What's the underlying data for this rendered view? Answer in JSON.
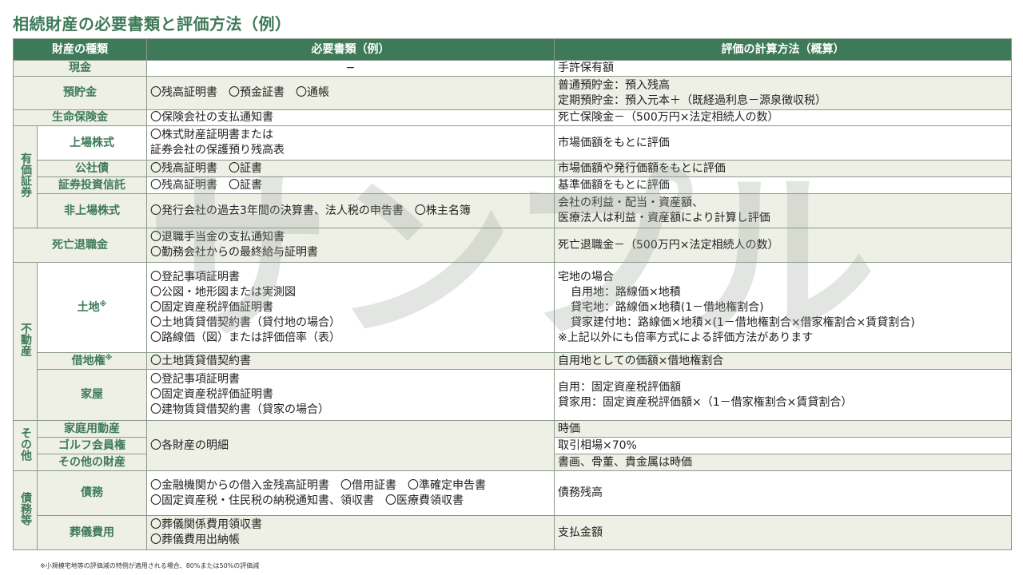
{
  "title": "相続財産の必要書類と評価方法（例）",
  "watermark_text": "サンプル",
  "headers": {
    "type": "財産の種類",
    "docs": "必要書類（例）",
    "eval": "評価の計算方法（概算）"
  },
  "groups": {
    "securities": "有価証券",
    "real_estate": "不動産",
    "other": "その他",
    "debts": "債務等"
  },
  "rows": {
    "cash": {
      "name": "現金",
      "docs": [
        "−"
      ],
      "eval": [
        "手許保有額"
      ]
    },
    "deposits": {
      "name": "預貯金",
      "docs": [
        "〇残高証明書　〇預金証書　〇通帳"
      ],
      "eval": [
        "普通預貯金：預入残高",
        "定期預貯金：預入元本＋（既経過利息－源泉徴収税）"
      ]
    },
    "life_insurance": {
      "name": "生命保険金",
      "docs": [
        "〇保険会社の支払通知書"
      ],
      "eval": [
        "死亡保険金－（500万円×法定相続人の数）"
      ]
    },
    "listed_stock": {
      "name": "上場株式",
      "docs": [
        "〇株式財産証明書または",
        "証券会社の保護預り残高表"
      ],
      "eval": [
        "市場価額をもとに評価"
      ]
    },
    "corporate_bonds": {
      "name": "公社債",
      "docs": [
        "〇残高証明書　〇証書"
      ],
      "eval": [
        "市場価額や発行価額をもとに評価"
      ]
    },
    "investment_trust": {
      "name": "証券投資信託",
      "docs": [
        "〇残高証明書　〇証書"
      ],
      "eval": [
        "基準価額をもとに評価"
      ]
    },
    "unlisted_stock": {
      "name": "非上場株式",
      "docs": [
        "〇発行会社の過去3年間の決算書、法人税の申告書　〇株主名簿"
      ],
      "eval": [
        "会社の利益・配当・資産額、",
        "医療法人は利益・資産額により計算し評価"
      ]
    },
    "retirement": {
      "name": "死亡退職金",
      "docs": [
        "〇退職手当金の支払通知書",
        "〇勤務会社からの最終給与証明書"
      ],
      "eval": [
        "死亡退職金－（500万円×法定相続人の数）"
      ]
    },
    "land": {
      "name": "土地",
      "mark": "※",
      "docs": [
        "〇登記事項証明書",
        "〇公図・地形図または実測図",
        "〇固定資産税評価証明書",
        "〇土地賃貸借契約書（貸付地の場合）",
        "〇路線価（図）または評価倍率（表）"
      ],
      "eval_head": "宅地の場合",
      "eval_sub": [
        "自用地：路線価×地積",
        "貸宅地：路線価×地積(1－借地権割合)",
        "貸家建付地：路線価×地積×(1－借地権割合×借家権割合×賃貸割合)"
      ],
      "eval_note": "※上記以外にも倍率方式による評価方法があります"
    },
    "leasehold": {
      "name": "借地権",
      "mark": "※",
      "docs": [
        "〇土地賃貸借契約書"
      ],
      "eval": [
        "自用地としての価額×借地権割合"
      ]
    },
    "house": {
      "name": "家屋",
      "docs": [
        "〇登記事項証明書",
        "〇固定資産税評価証明書",
        "〇建物賃貸借契約書（貸家の場合）"
      ],
      "eval": [
        "自用：固定資産税評価額",
        "貸家用：固定資産税評価額×（1－借家権割合×賃貸割合）"
      ]
    },
    "household": {
      "name": "家庭用動産",
      "eval": [
        "時価"
      ]
    },
    "golf": {
      "name": "ゴルフ会員権",
      "eval": [
        "取引相場×70%"
      ]
    },
    "other_assets": {
      "name": "その他の財産",
      "eval": [
        "書画、骨董、貴金属は時価"
      ]
    },
    "other_docs": [
      "〇各財産の明細"
    ],
    "debt": {
      "name": "債務",
      "docs": [
        "〇金融機関からの借入金残高証明書　〇借用証書　〇準確定申告書",
        "〇固定資産税・住民税の納税通知書、領収書　〇医療費領収書"
      ],
      "eval": [
        "債務残高"
      ]
    },
    "funeral": {
      "name": "葬儀費用",
      "docs": [
        "〇葬儀関係費用領収書",
        "〇葬儀費用出納帳"
      ],
      "eval": [
        "支払金額"
      ]
    }
  },
  "footnote": "※小規模宅地等の評価減の特例が適用される場合、80%または50%の評価減",
  "colors": {
    "accent": "#3e7a58",
    "shade": "#eef0e6",
    "border": "#8a9a8c"
  }
}
